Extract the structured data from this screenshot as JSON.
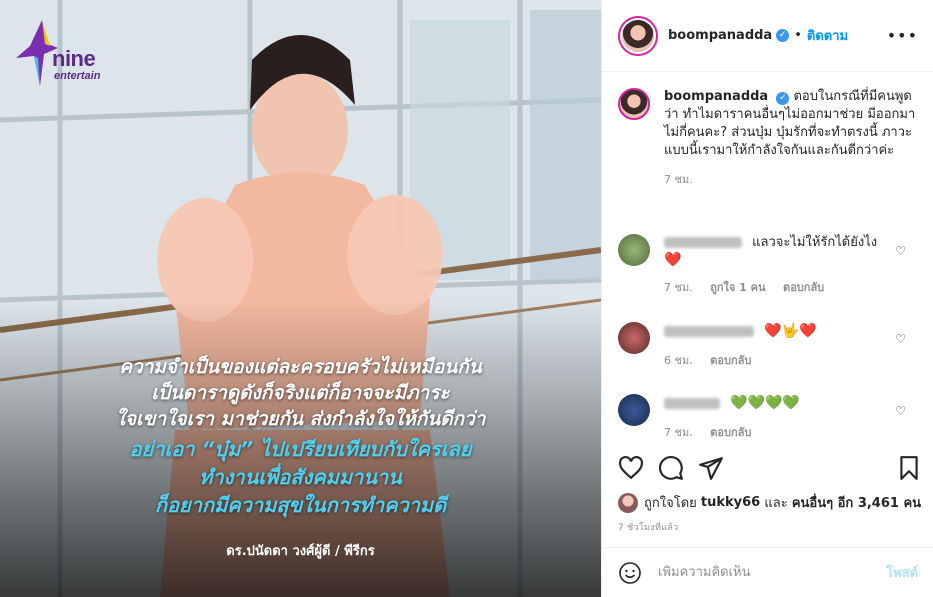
{
  "image": {
    "logo_line1": "nine",
    "logo_line2": "entertain",
    "caption_lines": [
      "ความจำเป็นของแต่ละครอบครัวไม่เหมือนกัน",
      "เป็นดาราดูดังก็จริงแต่ก็อาจจะมีภาระ",
      "ใจเขาใจเรา มาช่วยกัน ส่งกำลังใจให้กันดีกว่า"
    ],
    "highlight_lines": [
      "อย่าเอา “บุ๋ม” ไปเปรียบเทียบกับใครเลย",
      "ทำงานเพื่อสังคมมานาน",
      "ก็อยากมีความสุขในการทำความดี"
    ],
    "credit": "ดร.ปนัดดา วงศ์ผู้ดี / พีรีกร",
    "colors": {
      "caption": "#ffffff",
      "highlight": "#4fd0f0",
      "logo": "#5a2a8a"
    }
  },
  "header": {
    "username": "boompanadda",
    "verified_icon": "✓",
    "separator": "•",
    "follow_label": "ติดตาม",
    "more_label": "•••"
  },
  "post": {
    "username": "boompanadda",
    "verified_icon": "✓",
    "text": "ตอบในกรณีที่มีคนพูดว่า ทำไมดาราคนอื่นๆไม่ออกมาช่วย มีออกมาไม่กี่คนคะ? ส่วนบุ๋ม บุ๋มรักที่จะทำตรงนี้ ภาวะแบบนี้เรามาให้กำลังใจกันและกันดีกว่าค่ะ",
    "time": "7 ชม."
  },
  "comments": [
    {
      "text": "แลวจะไม่ให้รักได้ยังไง",
      "emoji": "❤️",
      "time": "7 ชม.",
      "likes": "ถูกใจ 1 คน",
      "reply": "ตอบกลับ",
      "heart": "♡"
    },
    {
      "text": "",
      "emoji": "❤️🤟❤️",
      "time": "6 ชม.",
      "likes": "",
      "reply": "ตอบกลับ",
      "heart": "♡"
    },
    {
      "text": "",
      "emoji": "💚💚💚💚",
      "time": "7 ชม.",
      "likes": "",
      "reply": "ตอบกลับ",
      "heart": "♡"
    }
  ],
  "likes": {
    "prefix": "ถูกใจโดย",
    "user": "tukky66",
    "middle": "และ",
    "others": "คนอื่นๆ อีก 3,461 คน"
  },
  "ago": "7 ชั่วโมงที่แล้ว",
  "add_comment": {
    "placeholder": "เพิ่มความคิดเห็น",
    "post_label": "โพสต์",
    "emoji_icon": "smile-icon"
  }
}
